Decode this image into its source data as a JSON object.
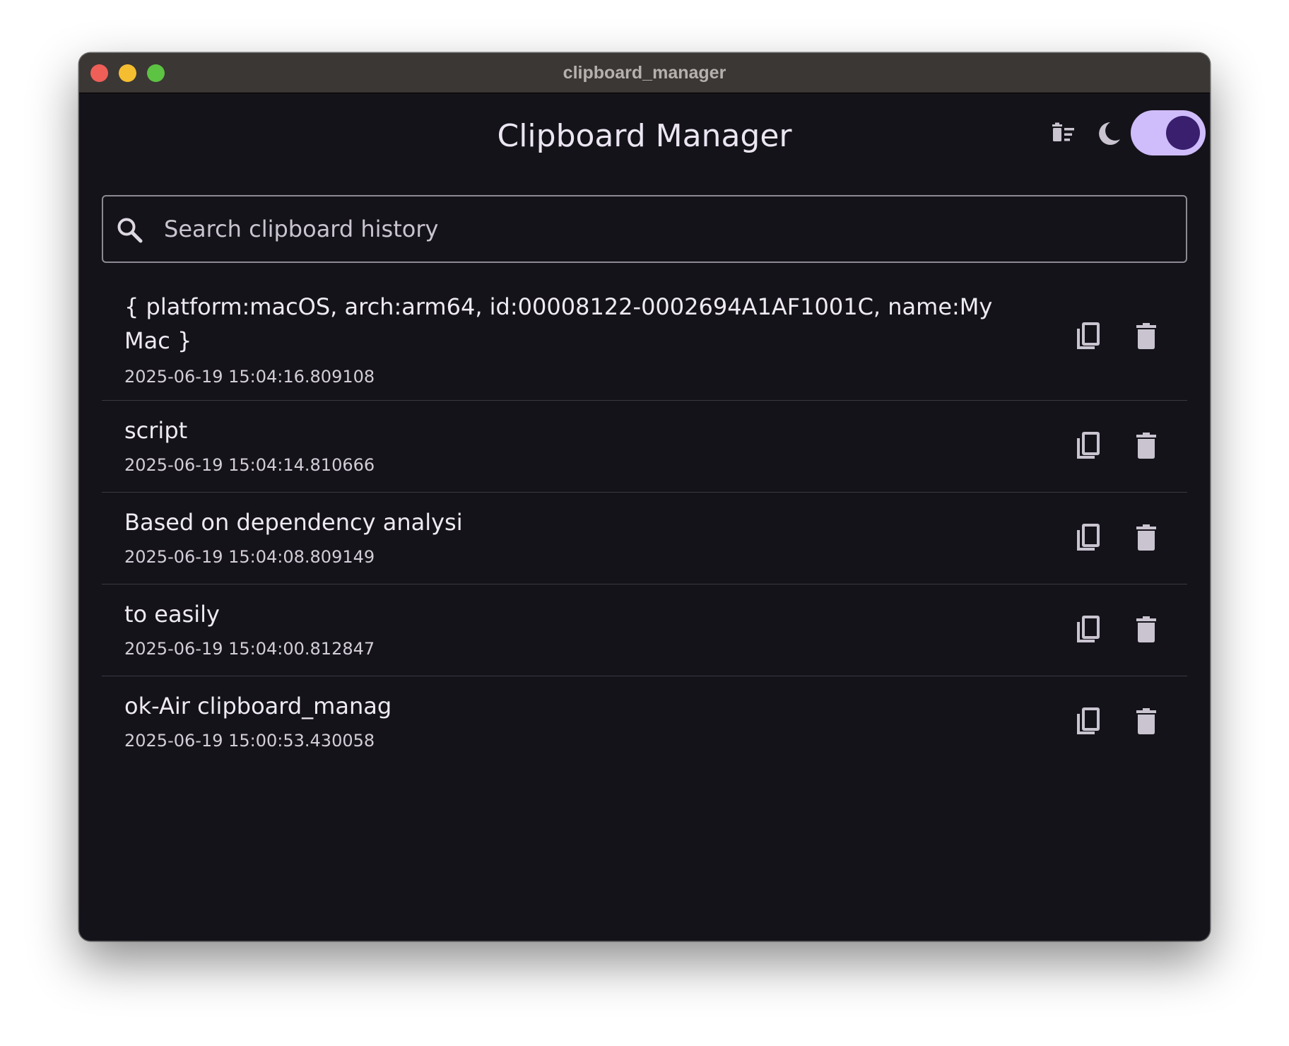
{
  "window": {
    "title": "clipboard_manager"
  },
  "header": {
    "title": "Clipboard Manager",
    "clear_all_icon": "clear-all-icon",
    "theme_icon": "moon-icon",
    "dark_mode_enabled": true
  },
  "search": {
    "placeholder": "Search clipboard history",
    "value": ""
  },
  "colors": {
    "window_bg": "#15131a",
    "titlebar_bg": "#3b3735",
    "accent": "#cfbcfb",
    "accent_dark": "#3a1f6e",
    "icon": "#c9c4d0"
  },
  "items": [
    {
      "text": "{ platform:macOS, arch:arm64, id:00008122-0002694A1AF1001C, name:My Mac }",
      "timestamp": "2025-06-19 15:04:16.809108"
    },
    {
      "text": "script",
      "timestamp": "2025-06-19 15:04:14.810666"
    },
    {
      "text": "Based on dependency analysi",
      "timestamp": "2025-06-19 15:04:08.809149"
    },
    {
      "text": "to easily",
      "timestamp": "2025-06-19 15:04:00.812847"
    },
    {
      "text": "ok-Air clipboard_manag",
      "timestamp": "2025-06-19 15:00:53.430058"
    }
  ]
}
